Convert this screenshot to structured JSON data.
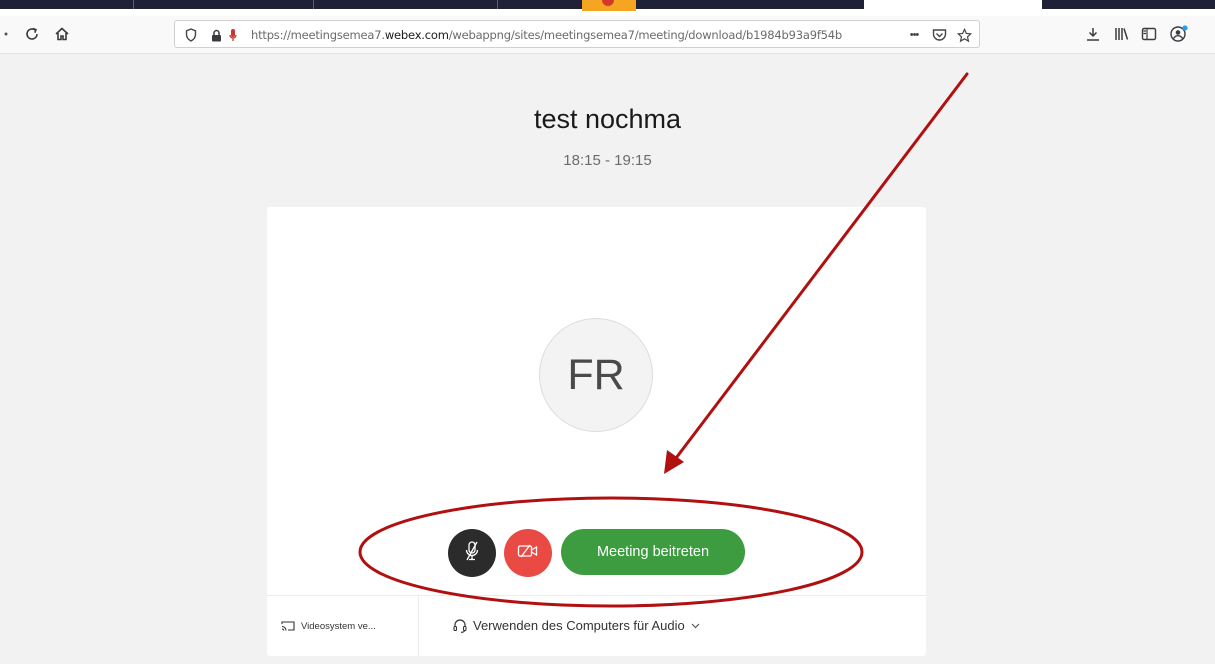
{
  "browser": {
    "url_prefix": "https://meetingsemea7.",
    "url_domain": "webex.com",
    "url_path": "/webappng/sites/meetingsemea7/meeting/download/b1984b93a9f54b",
    "more_label": "•••"
  },
  "meeting": {
    "title": "test nochma",
    "time": "18:15 - 19:15",
    "avatar_initials": "FR",
    "join_label": "Meeting beitreten",
    "video_system_label": "Videosystem ve...",
    "audio_label": "Verwenden des Computers für Audio"
  },
  "annotation": {
    "color": "#b01010"
  },
  "colors": {
    "join_green": "#3c9c3f",
    "video_red": "#ea4a44",
    "mute_dark": "#2b2b2b"
  },
  "icons": {
    "toolbar": [
      "reload-icon",
      "home-icon",
      "shield-icon",
      "lock-icon",
      "microphone-icon",
      "pocket-icon",
      "bookmark-star-icon",
      "download-icon",
      "library-icon",
      "sidebar-icon",
      "account-icon"
    ],
    "controls": [
      "muted-microphone-icon",
      "video-off-icon",
      "cast-icon",
      "headset-icon",
      "chevron-down-icon"
    ]
  }
}
